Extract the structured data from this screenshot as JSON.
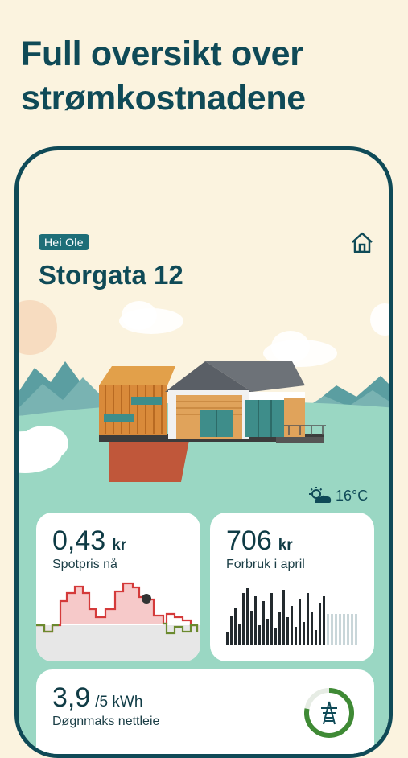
{
  "headline": "Full oversikt over strømkostnadene",
  "app": {
    "greeting": "Hei Ole",
    "address": "Storgata 12",
    "home_icon": "home-icon",
    "weather": {
      "icon": "partly-cloudy-icon",
      "temperature": "16°C"
    }
  },
  "cards": {
    "spot": {
      "value": "0,43",
      "unit": "kr",
      "label": "Spotpris nå"
    },
    "consumption": {
      "value": "706",
      "unit": "kr",
      "label": "Forbruk i april"
    },
    "capacity": {
      "value": "3,9",
      "unit": "/5 kWh",
      "label": "Døgnmaks nettleie",
      "icon": "power-pylon-icon",
      "progress": 0.78
    }
  },
  "colors": {
    "primary": "#0f4a57",
    "background": "#fbf3df",
    "ground": "#9ad7c3",
    "price_high": "#d43a3a",
    "price_low": "#6b8a2e"
  }
}
